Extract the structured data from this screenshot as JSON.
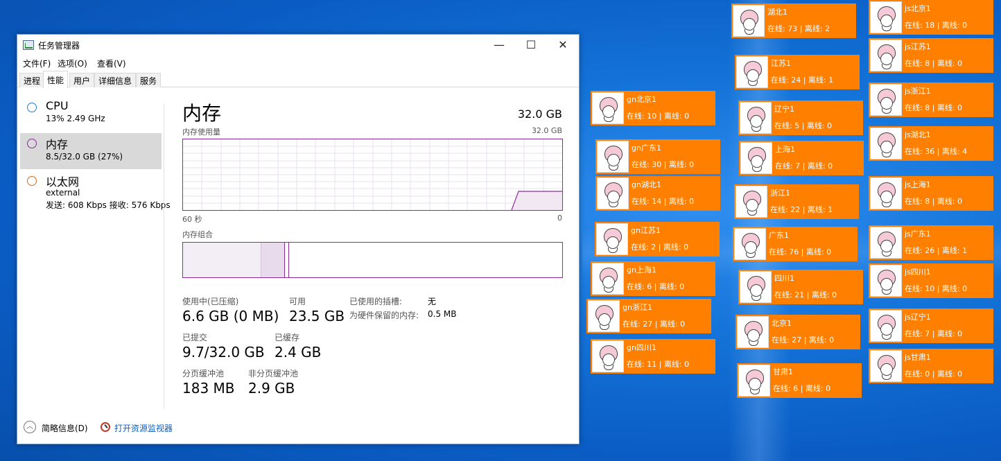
{
  "window": {
    "title": "任务管理器",
    "minimize": "—",
    "maximize": "☐",
    "close": "✕"
  },
  "menu": [
    "文件(F)",
    "选项(O)",
    "查看(V)"
  ],
  "tabs": [
    "进程",
    "性能",
    "用户",
    "详细信息",
    "服务"
  ],
  "sidebar": {
    "cpu": {
      "name": "CPU",
      "sub": "13% 2.49 GHz",
      "color": "#1a7fd4"
    },
    "memory": {
      "name": "内存",
      "sub": "8.5/32.0 GB (27%)",
      "color": "#8b2b9b"
    },
    "ethernet": {
      "name": "以太网",
      "sub1": "external",
      "sub2": "发送: 608 Kbps 接收: 576 Kbps",
      "color": "#d2691e"
    }
  },
  "main": {
    "title": "内存",
    "total": "32.0 GB",
    "usage_label": "内存使用量",
    "usage_max": "32.0 GB",
    "axis_left": "60 秒",
    "axis_right": "0",
    "composition_label": "内存组合",
    "in_use_label": "使用中(已压缩)",
    "in_use_value": "6.6 GB (0 MB)",
    "available_label": "可用",
    "available_value": "23.5 GB",
    "slots_label": "已使用的插槽:",
    "slots_value": "无",
    "reserved_label": "为硬件保留的内存:",
    "reserved_value": "0.5 MB",
    "committed_label": "已提交",
    "committed_value": "9.7/32.0 GB",
    "cached_label": "已缓存",
    "cached_value": "2.4 GB",
    "paged_label": "分页缓冲池",
    "paged_value": "183 MB",
    "nonpaged_label": "非分页缓冲池",
    "nonpaged_value": "2.9 GB"
  },
  "footer": {
    "fewer": "简略信息(D)",
    "resmon": "打开资源监视器"
  },
  "cards": [
    {
      "name": "湖北1",
      "stat": "在线: 73 | 离线: 2"
    },
    {
      "name": "江苏1",
      "stat": "在线: 24 | 离线: 1"
    },
    {
      "name": "辽宁1",
      "stat": "在线: 5 | 离线: 0"
    },
    {
      "name": "上海1",
      "stat": "在线: 7 | 离线: 0"
    },
    {
      "name": "浙江1",
      "stat": "在线: 22 | 离线: 1"
    },
    {
      "name": "广东1",
      "stat": "在线: 76 | 离线: 0"
    },
    {
      "name": "四川1",
      "stat": "在线: 21 | 离线: 0"
    },
    {
      "name": "北京1",
      "stat": "在线: 27 | 离线: 0"
    },
    {
      "name": "甘肃1",
      "stat": "在线: 6 | 离线: 0"
    },
    {
      "name": "gn北京1",
      "stat": "在线: 10 | 离线: 0"
    },
    {
      "name": "gn广东1",
      "stat": "在线: 30 | 离线: 0"
    },
    {
      "name": "gn湖北1",
      "stat": "在线: 14 | 离线: 0"
    },
    {
      "name": "gn江苏1",
      "stat": "在线: 2 | 离线: 0"
    },
    {
      "name": "gn上海1",
      "stat": "在线: 6 | 离线: 0"
    },
    {
      "name": "gn浙江1",
      "stat": "在线: 27 | 离线: 0"
    },
    {
      "name": "gn四川1",
      "stat": "在线: 11 | 离线: 0"
    },
    {
      "name": "js北京1",
      "stat": "在线: 18 | 离线: 0"
    },
    {
      "name": "js江苏1",
      "stat": "在线: 8 | 离线: 0"
    },
    {
      "name": "js浙江1",
      "stat": "在线: 8 | 离线: 0"
    },
    {
      "name": "js湖北1",
      "stat": "在线: 36 | 离线: 4"
    },
    {
      "name": "js上海1",
      "stat": "在线: 8 | 离线: 0"
    },
    {
      "name": "js广东1",
      "stat": "在线: 26 | 离线: 1"
    },
    {
      "name": "js四川1",
      "stat": "在线: 10 | 离线: 0"
    },
    {
      "name": "js辽宁1",
      "stat": "在线: 7 | 离线: 0"
    },
    {
      "name": "js甘肃1",
      "stat": "在线: 0 | 离线: 0"
    }
  ]
}
